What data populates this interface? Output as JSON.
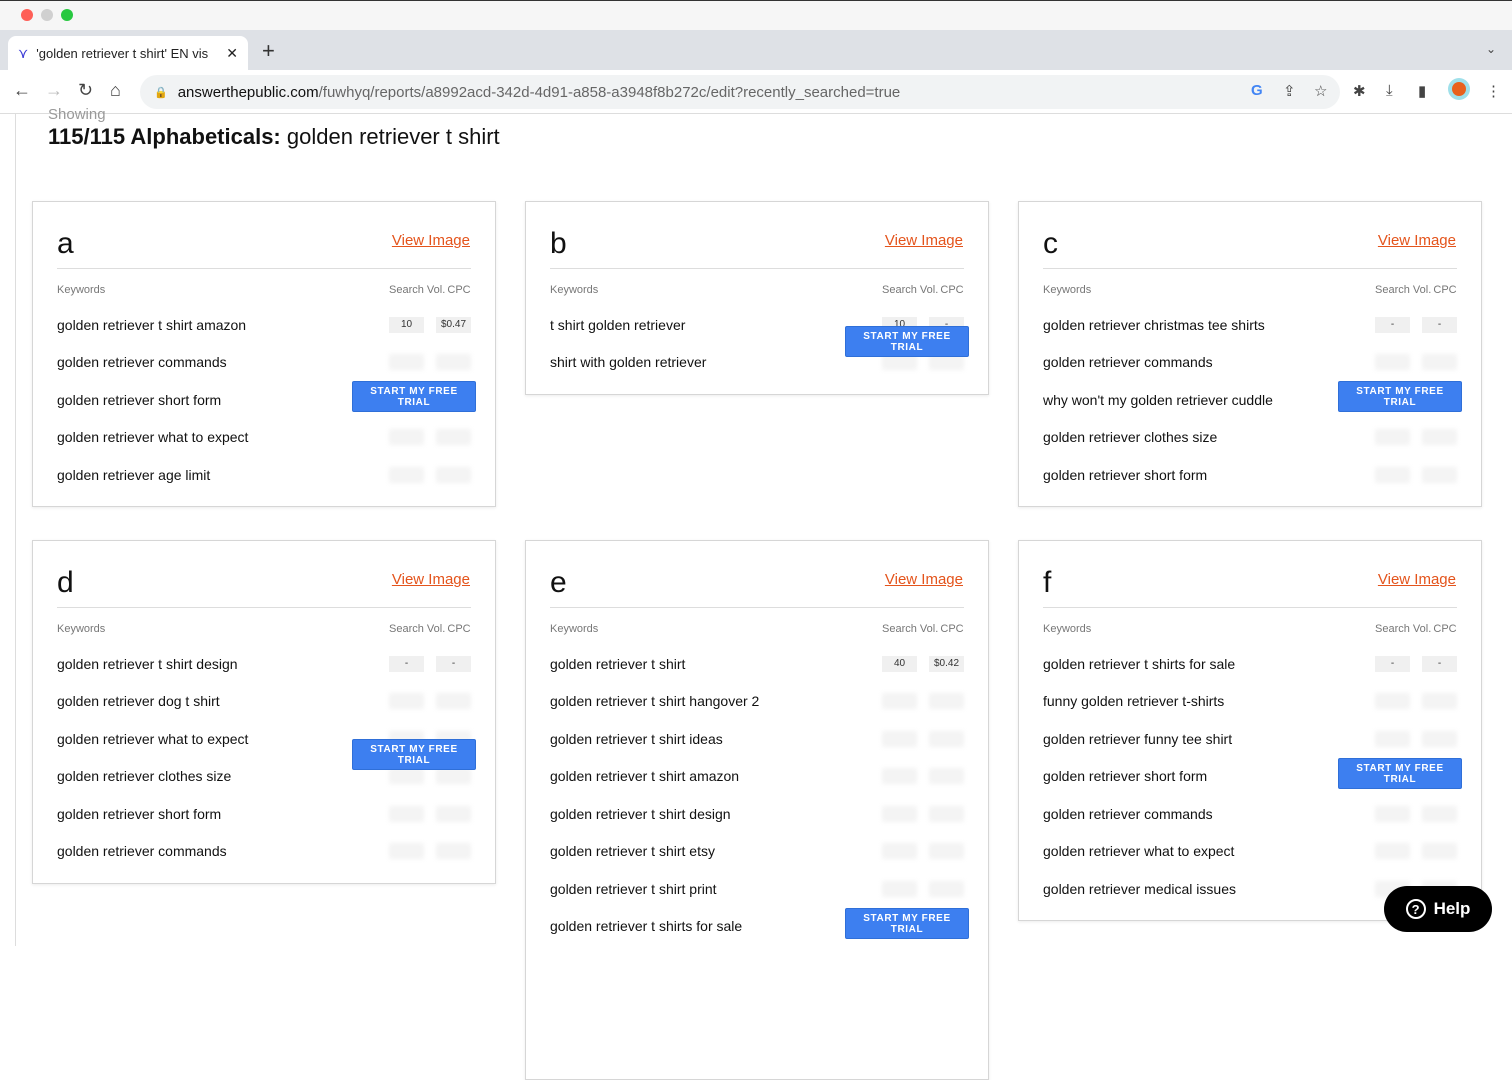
{
  "browser": {
    "tab_title": "'golden retriever t shirt' EN vis",
    "url_host": "answerthepublic.com",
    "url_path": "/fuwhyq/reports/a8992acd-342d-4d91-a858-a3948f8b272c/edit?recently_searched=true"
  },
  "page": {
    "showing": "Showing",
    "heading_bold": "115/115 Alphabeticals:",
    "heading_term": "golden retriever t shirt",
    "help_label": "Help"
  },
  "labels": {
    "view_image": "View Image",
    "keywords": "Keywords",
    "search_vol": "Search Vol.",
    "cpc": "CPC",
    "trial": "START MY FREE TRIAL"
  },
  "colors": {
    "link": "#e4541c",
    "trial_button": "#3d7ff0"
  },
  "cards": [
    {
      "letter": "a",
      "rows": [
        {
          "k": "golden retriever t shirt amazon",
          "vol": "10",
          "cpc": "$0.47"
        },
        {
          "k": "golden retriever commands"
        },
        {
          "k": "golden retriever short form"
        },
        {
          "k": "golden retriever what to expect"
        },
        {
          "k": "golden retriever age limit"
        }
      ]
    },
    {
      "letter": "b",
      "rows": [
        {
          "k": "t shirt golden retriever",
          "vol": "10",
          "cpc": "-"
        },
        {
          "k": "shirt with golden retriever"
        }
      ]
    },
    {
      "letter": "c",
      "rows": [
        {
          "k": "golden retriever christmas tee shirts",
          "vol": "-",
          "cpc": "-"
        },
        {
          "k": "golden retriever commands"
        },
        {
          "k": "why won't my golden retriever cuddle"
        },
        {
          "k": "golden retriever clothes size"
        },
        {
          "k": "golden retriever short form"
        }
      ]
    },
    {
      "letter": "d",
      "rows": [
        {
          "k": "golden retriever t shirt design",
          "vol": "-",
          "cpc": "-"
        },
        {
          "k": "golden retriever dog t shirt"
        },
        {
          "k": "golden retriever what to expect"
        },
        {
          "k": "golden retriever clothes size"
        },
        {
          "k": "golden retriever short form"
        },
        {
          "k": "golden retriever commands"
        }
      ]
    },
    {
      "letter": "e",
      "rows": [
        {
          "k": "golden retriever t shirt",
          "vol": "40",
          "cpc": "$0.42"
        },
        {
          "k": "golden retriever t shirt hangover 2"
        },
        {
          "k": "golden retriever t shirt ideas"
        },
        {
          "k": "golden retriever t shirt amazon"
        },
        {
          "k": "golden retriever t shirt design"
        },
        {
          "k": "golden retriever t shirt etsy"
        },
        {
          "k": "golden retriever t shirt print"
        },
        {
          "k": "golden retriever t shirts for sale"
        }
      ]
    },
    {
      "letter": "f",
      "rows": [
        {
          "k": "golden retriever t shirts for sale",
          "vol": "-",
          "cpc": "-"
        },
        {
          "k": "funny golden retriever t-shirts"
        },
        {
          "k": "golden retriever funny tee shirt"
        },
        {
          "k": "golden retriever short form"
        },
        {
          "k": "golden retriever commands"
        },
        {
          "k": "golden retriever what to expect"
        },
        {
          "k": "golden retriever medical issues"
        }
      ]
    }
  ]
}
